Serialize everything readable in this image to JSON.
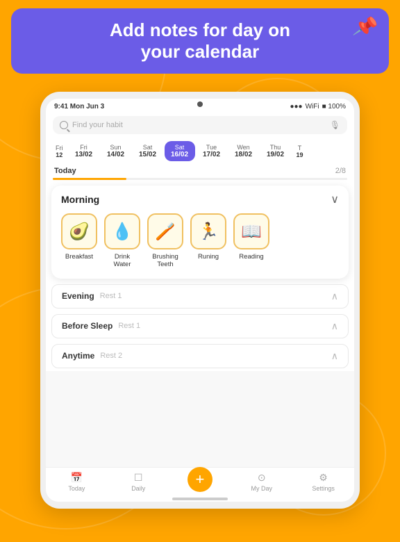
{
  "header": {
    "title_line1": "Add notes for day on",
    "title_line2": "your calendar",
    "pin_emoji": "📌"
  },
  "status_bar": {
    "time": "9:41 Mon Jun 3",
    "signal": "●●●",
    "wifi": "WiFi",
    "battery": "100%"
  },
  "search": {
    "placeholder": "Find your habit"
  },
  "calendar": {
    "days": [
      {
        "name": "Fri",
        "date": "13/02",
        "active": false
      },
      {
        "name": "Sun",
        "date": "14/02",
        "active": false
      },
      {
        "name": "Sat",
        "date": "15/02",
        "active": false
      },
      {
        "name": "Sat",
        "date": "16/02",
        "active": true
      },
      {
        "name": "Tue",
        "date": "17/02",
        "active": false
      },
      {
        "name": "Wen",
        "date": "18/02",
        "active": false
      },
      {
        "name": "Thu",
        "date": "19/02",
        "active": false
      }
    ]
  },
  "today": {
    "label": "Today",
    "count": "2/8",
    "progress": 25
  },
  "morning_section": {
    "title": "Morning",
    "habits": [
      {
        "emoji": "🥑",
        "label": "Breakfast"
      },
      {
        "emoji": "💧",
        "label": "Drink Water"
      },
      {
        "emoji": "🪥",
        "label": "Brushing Teeth"
      },
      {
        "emoji": "🏃",
        "label": "Runing"
      },
      {
        "emoji": "📖",
        "label": "Reading"
      }
    ]
  },
  "collapsed_sections": [
    {
      "title": "Evening",
      "rest": "Rest 1"
    },
    {
      "title": "Before Sleep",
      "rest": "Rest 1"
    },
    {
      "title": "Anytime",
      "rest": "Rest 2"
    }
  ],
  "tab_bar": {
    "items": [
      {
        "icon": "📅",
        "label": "Today"
      },
      {
        "icon": "☐",
        "label": "Daily"
      },
      {
        "icon": "+",
        "label": "",
        "is_add": true
      },
      {
        "icon": "⊙",
        "label": "My Day"
      },
      {
        "icon": "⚙",
        "label": "Settings"
      }
    ]
  }
}
